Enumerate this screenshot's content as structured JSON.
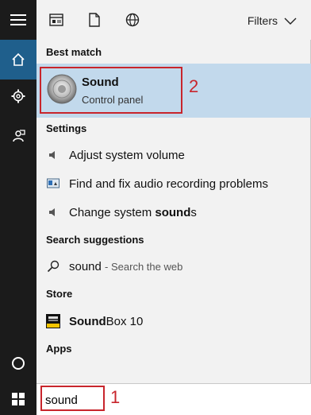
{
  "topbar": {
    "filters_label": "Filters",
    "icons": [
      "apps-icon",
      "document-icon",
      "web-icon"
    ]
  },
  "sections": {
    "best_match": "Best match",
    "settings": "Settings",
    "search_suggestions": "Search suggestions",
    "store": "Store",
    "apps": "Apps"
  },
  "best_match": {
    "title": "Sound",
    "subtitle": "Control panel"
  },
  "settings_items": [
    {
      "label": "Adjust system volume"
    },
    {
      "label": "Find and fix audio recording problems"
    },
    {
      "label_pre": "Change system ",
      "label_bold": "sound",
      "label_post": "s"
    }
  ],
  "suggestion": {
    "query": "sound",
    "hint": "- Search the web"
  },
  "store_item": {
    "bold": "Sound",
    "rest": "Box 10"
  },
  "search": {
    "value": "sound"
  },
  "annotations": {
    "one": "1",
    "two": "2"
  },
  "colors": {
    "highlight": "#c2d9ec",
    "rail": "#1b1b1b",
    "active_rail": "#1f5f8c",
    "annotation": "#c8252c"
  }
}
